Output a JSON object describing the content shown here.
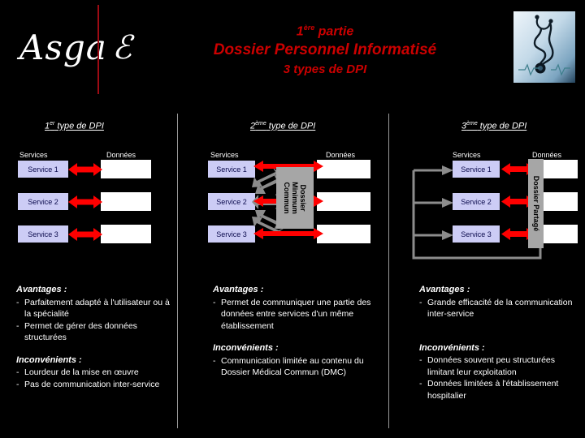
{
  "header": {
    "logo_text": "Asga",
    "logo_mark": "ℰ",
    "part_prefix": "1",
    "part_sup": "ère",
    "part_suffix": " partie",
    "title": "Dossier Personnel Informatisé",
    "subtitle": "3 types de DPI",
    "photo_alt": "stethoscope-photo"
  },
  "columns": [
    {
      "title_num": "1",
      "title_sup": "er",
      "title_rest": " type de DPI",
      "header_services": "Services",
      "header_donnees": "Données",
      "services": [
        "Service 1",
        "Service 2",
        "Service 3"
      ],
      "shared_box": "",
      "advantages_label": "Avantages :",
      "advantages": [
        "Parfaitement adapté à l'utilisateur ou à la spécialité",
        "Permet de gérer des données structurées"
      ],
      "drawbacks_label": "Inconvénients :",
      "drawbacks": [
        "Lourdeur de la mise en œuvre",
        "Pas de communication inter-service"
      ]
    },
    {
      "title_num": "2",
      "title_sup": "ème",
      "title_rest": " type de DPI",
      "header_services": "Services",
      "header_donnees": "Données",
      "services": [
        "Service 1",
        "Service 2",
        "Service 3"
      ],
      "shared_box": "Dossier Minimum Commun",
      "shared_box_lines": [
        "Dossier",
        "Minimum",
        "Commun"
      ],
      "advantages_label": "Avantages :",
      "advantages": [
        "Permet de communiquer une partie des données entre services d'un même établissement"
      ],
      "drawbacks_label": "Inconvénients :",
      "drawbacks": [
        "Communication limitée au contenu du Dossier Médical Commun (DMC)"
      ]
    },
    {
      "title_num": "3",
      "title_sup": "ème",
      "title_rest": " type de DPI",
      "header_services": "Services",
      "header_donnees": "Données",
      "services": [
        "Service 1",
        "Service 2",
        "Service 3"
      ],
      "shared_box": "Dossier Partagé",
      "advantages_label": "Avantages :",
      "advantages": [
        "Grande efficacité de la communication inter-service"
      ],
      "drawbacks_label": "Inconvénients :",
      "drawbacks": [
        "Données souvent peu structurées limitant leur exploitation",
        "Données limitées à l'établissement hospitalier"
      ]
    }
  ],
  "colors": {
    "background": "#000000",
    "title_red": "#cc0000",
    "logo_rule_red": "#9e0b14",
    "service_box": "#ccccf5",
    "service_text": "#0b0b4d",
    "data_box": "#ffffff",
    "shared_box_gray": "#a6a6a6",
    "arrow_red": "#ff0000",
    "arrow_gray": "#8c8c8c",
    "divider_gray": "#9a9a9a",
    "text_white": "#ffffff"
  }
}
